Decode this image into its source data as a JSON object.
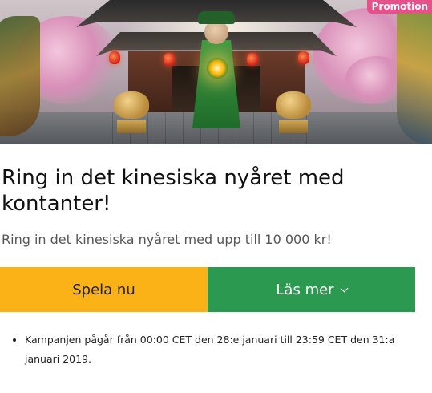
{
  "badge": {
    "label": "Promotion",
    "color": "#e8508a"
  },
  "hero": {
    "icons": [
      "temple-illustration",
      "mr-green-character",
      "golden-pig-statue",
      "dragon-statue",
      "cherry-blossom",
      "red-lantern"
    ]
  },
  "promo": {
    "title": "Ring in det kinesiska nyåret med kontanter!",
    "subtitle": "Ring in det kinesiska nyåret med upp till 10 000 kr!"
  },
  "actions": {
    "play_label": "Spela nu",
    "play_color": "#fbb216",
    "more_label": "Läs mer",
    "more_color": "#2b9950",
    "more_icon": "chevron-down-icon"
  },
  "terms": [
    "Kampanjen pågår från 00:00 CET den 28:e januari till 23:59 CET den 31:a januari 2019."
  ]
}
